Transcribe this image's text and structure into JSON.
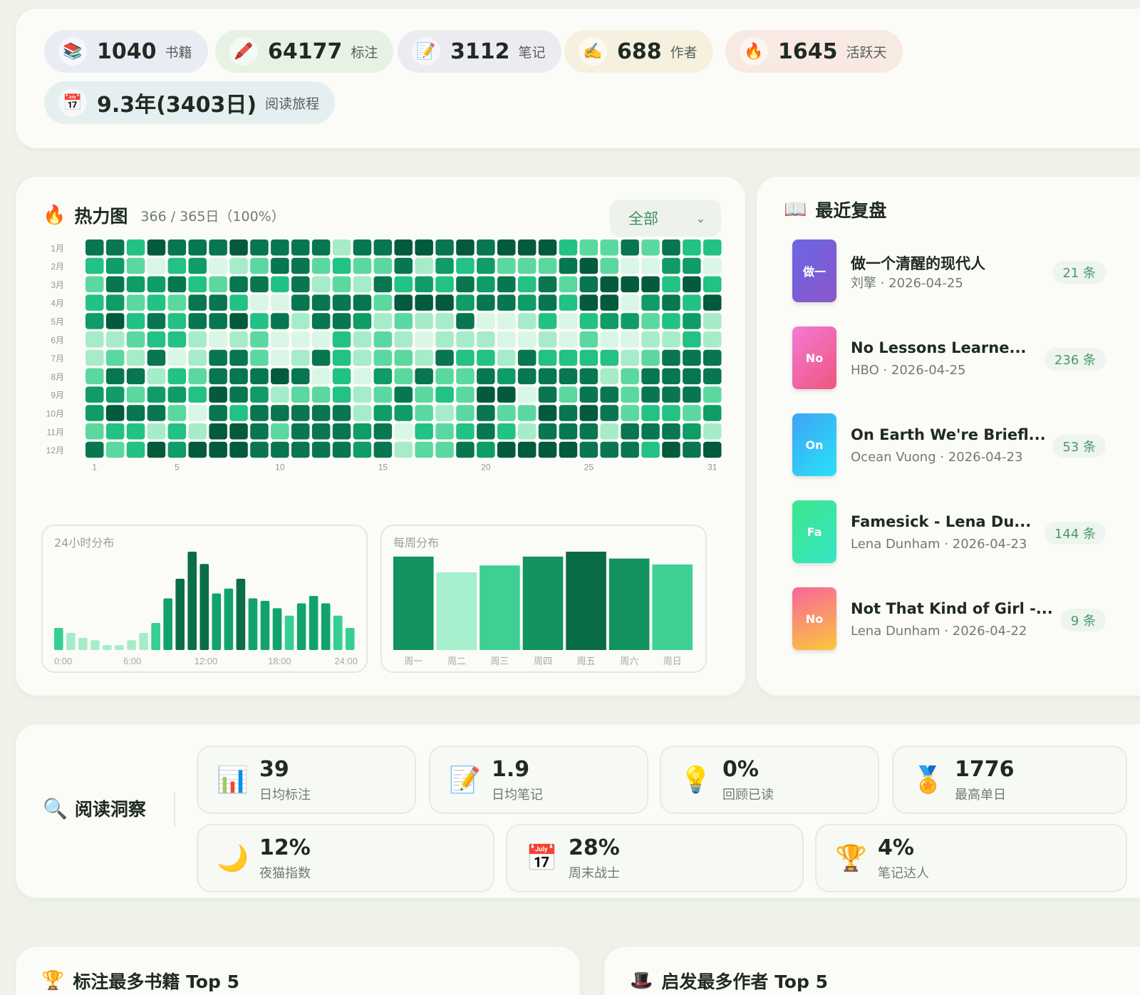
{
  "stats": [
    {
      "icon": "📚",
      "icon_name": "books-icon",
      "value": "1040",
      "label": "书籍",
      "bg": "#e9edf3"
    },
    {
      "icon": "🖍️",
      "icon_name": "crayon-icon",
      "value": "64177",
      "label": "标注",
      "bg": "#e8f2e4"
    },
    {
      "icon": "📝",
      "icon_name": "memo-icon",
      "value": "3112",
      "label": "笔记",
      "bg": "#ecebf1"
    },
    {
      "icon": "✍️",
      "icon_name": "writing-hand-icon",
      "value": "688",
      "label": "作者",
      "bg": "#f6f1de"
    },
    {
      "icon": "🔥",
      "icon_name": "fire-icon",
      "value": "1645",
      "label": "活跃天",
      "bg": "#f8e9e3"
    }
  ],
  "journey": {
    "icon": "📅",
    "icon_name": "calendar-icon",
    "value": "9.3年(3403日)",
    "label": "阅读旅程",
    "bg": "#e6eff0"
  },
  "heatmap": {
    "icon": "🔥",
    "title": "热力图",
    "subtitle": "366 / 365日（100%）",
    "filter_value": "全部",
    "filter_chevron": "⌄",
    "months": [
      "1月",
      "2月",
      "3月",
      "4月",
      "5月",
      "6月",
      "7月",
      "8月",
      "9月",
      "10月",
      "11月",
      "12月"
    ],
    "day_ticks": [
      "1",
      "5",
      "10",
      "15",
      "20",
      "25",
      "31"
    ],
    "colors": [
      "#d9f6e6",
      "#a6ecc8",
      "#5ad8a0",
      "#22c184",
      "#0f9c66",
      "#087651",
      "#045a3d"
    ],
    "rows": [
      "5536555655551556656566632252533",
      "3420340125523225143422256200440",
      "2544532553512153435453525666363",
      "3423255300555526664554536604536",
      "4635355635155412115001303442341",
      "1123310120003121011100102001131",
      "1215015520153122153315333312555",
      "2551325556503042522545555125555",
      "4424436541223125232660525525552",
      "4655205355555144212522656523324",
      "2331316652555450323531555155541",
      "5236466655555451225466665553656"
    ]
  },
  "hourly": {
    "title": "24小时分布",
    "ticks": [
      "0:00",
      "6:00",
      "12:00",
      "18:00",
      "24:00"
    ],
    "values": [
      9,
      7,
      5,
      4,
      2,
      2,
      4,
      7,
      11,
      21,
      29,
      40,
      35,
      23,
      25,
      29,
      21,
      20,
      17,
      14,
      19,
      22,
      19,
      14,
      9
    ]
  },
  "weekly": {
    "title": "每周分布",
    "labels": [
      "周一",
      "周二",
      "周三",
      "周四",
      "周五",
      "周六",
      "周日"
    ],
    "values": [
      95,
      79,
      86,
      95,
      100,
      93,
      87
    ]
  },
  "recent": {
    "icon": "📖",
    "title": "最近复盘",
    "books": [
      {
        "cover": "做一",
        "title": "做一个清醒的现代人",
        "meta": "刘擎 · 2026-04-25",
        "count": "21 条",
        "gradient": "linear-gradient(135deg,#6a66e6,#8b56c9)"
      },
      {
        "cover": "No",
        "title": "No Lessons Learne...",
        "meta": "HBO · 2026-04-25",
        "count": "236 条",
        "gradient": "linear-gradient(135deg,#f27ad6,#f0557d)"
      },
      {
        "cover": "On",
        "title": "On Earth We're Briefl...",
        "meta": "Ocean Vuong · 2026-04-23",
        "count": "53 条",
        "gradient": "linear-gradient(135deg,#3fa3f7,#28e2f5)"
      },
      {
        "cover": "Fa",
        "title": "Famesick - Lena Du...",
        "meta": "Lena Dunham · 2026-04-23",
        "count": "144 条",
        "gradient": "linear-gradient(135deg,#3fe48d,#35e6c5)"
      },
      {
        "cover": "No",
        "title": "Not That Kind of Girl -...",
        "meta": "Lena Dunham · 2026-04-22",
        "count": "9 条",
        "gradient": "linear-gradient(160deg,#f9659a,#fbc73c)"
      }
    ]
  },
  "insights": {
    "icon": "🔍",
    "title": "阅读洞察",
    "row1": [
      {
        "icon": "📊",
        "icon_name": "bar-chart-icon",
        "value": "39",
        "label": "日均标注"
      },
      {
        "icon": "📝",
        "icon_name": "memo-icon",
        "value": "1.9",
        "label": "日均笔记"
      },
      {
        "icon": "💡",
        "icon_name": "lightbulb-icon",
        "value": "0%",
        "label": "回顾已读"
      },
      {
        "icon": "🏅",
        "icon_name": "medal-icon",
        "value": "1776",
        "label": "最高单日"
      }
    ],
    "row2": [
      {
        "icon": "🌙",
        "icon_name": "moon-icon",
        "value": "12%",
        "label": "夜猫指数"
      },
      {
        "icon": "📅",
        "icon_name": "calendar-icon",
        "value": "28%",
        "label": "周末战士"
      },
      {
        "icon": "🏆",
        "icon_name": "trophy-icon",
        "value": "4%",
        "label": "笔记达人"
      }
    ]
  },
  "bottom": {
    "left": {
      "icon": "🏆",
      "title": "标注最多书籍 Top 5"
    },
    "right": {
      "icon": "🎩",
      "title": "启发最多作者 Top 5"
    }
  }
}
